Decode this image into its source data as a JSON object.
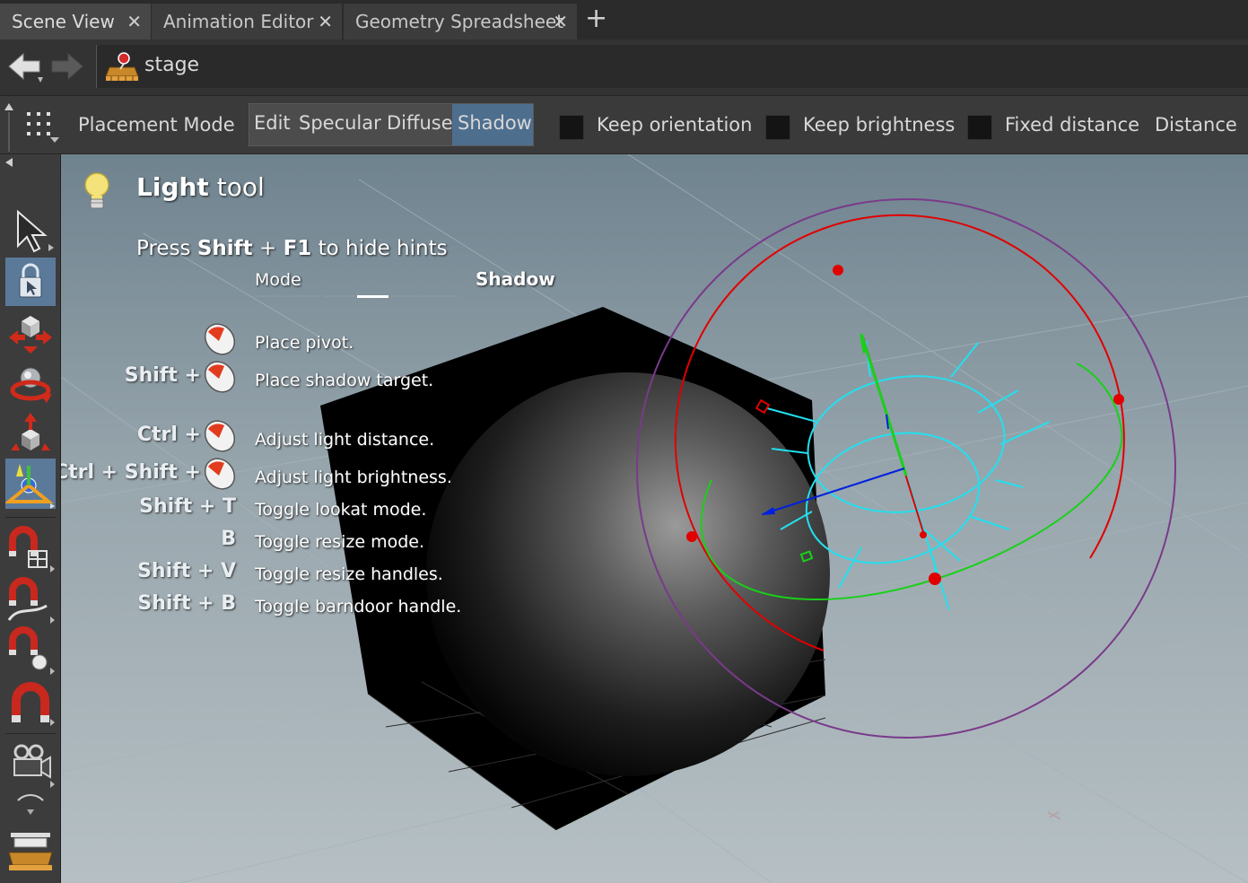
{
  "tabs": [
    {
      "label": "Scene View",
      "close": "✕"
    },
    {
      "label": "Animation Editor",
      "close": "✕"
    },
    {
      "label": "Geometry Spreadsheet",
      "close": "✕"
    }
  ],
  "add_tab": "+",
  "path": {
    "text": "stage"
  },
  "toolbar": {
    "placement_mode": "Placement Mode",
    "modes": [
      "Edit",
      "Specular",
      "Diffuse",
      "Shadow"
    ],
    "active_mode": "Shadow",
    "checkboxes": [
      {
        "label": "Keep orientation",
        "checked": false
      },
      {
        "label": "Keep brightness",
        "checked": false
      },
      {
        "label": "Fixed distance",
        "checked": false
      }
    ],
    "distance_label": "Distance"
  },
  "hints": {
    "title_bold": "Light",
    "title_rest": " tool",
    "sub_pre": "Press ",
    "sub_key1": "Shift",
    "sub_plus": " + ",
    "sub_key2": "F1",
    "sub_post": " to hide hints",
    "mode_label": "Mode",
    "mode_value": "Shadow",
    "items": [
      {
        "key": "",
        "desc": "Place pivot."
      },
      {
        "key": "Shift +",
        "desc": "Place shadow target."
      },
      {
        "key": "Ctrl +",
        "desc": "Adjust light distance."
      },
      {
        "key": "Ctrl + Shift +",
        "desc": "Adjust light brightness."
      },
      {
        "key": "Shift + T",
        "desc": "Toggle lookat mode."
      },
      {
        "key": "B",
        "desc": "Toggle resize mode."
      },
      {
        "key": "Shift + V",
        "desc": "Toggle resize handles."
      },
      {
        "key": "Shift + B",
        "desc": "Toggle barndoor handle."
      }
    ]
  },
  "left_tools": [
    "select-arrow-icon",
    "lock-select-icon",
    "move-tool-icon",
    "rotate-tool-icon",
    "scale-tool-icon",
    "light-tool-icon",
    "snap-grid-icon",
    "snap-curve-icon",
    "snap-point-icon",
    "snap-magnet-icon",
    "camera-icon",
    "stage-icon"
  ],
  "colors": {
    "accent": "#5b7a9a",
    "mode_active": "#4e6e8e",
    "viewport_top": "#6f838f",
    "viewport_bottom": "#b6c0c4"
  }
}
